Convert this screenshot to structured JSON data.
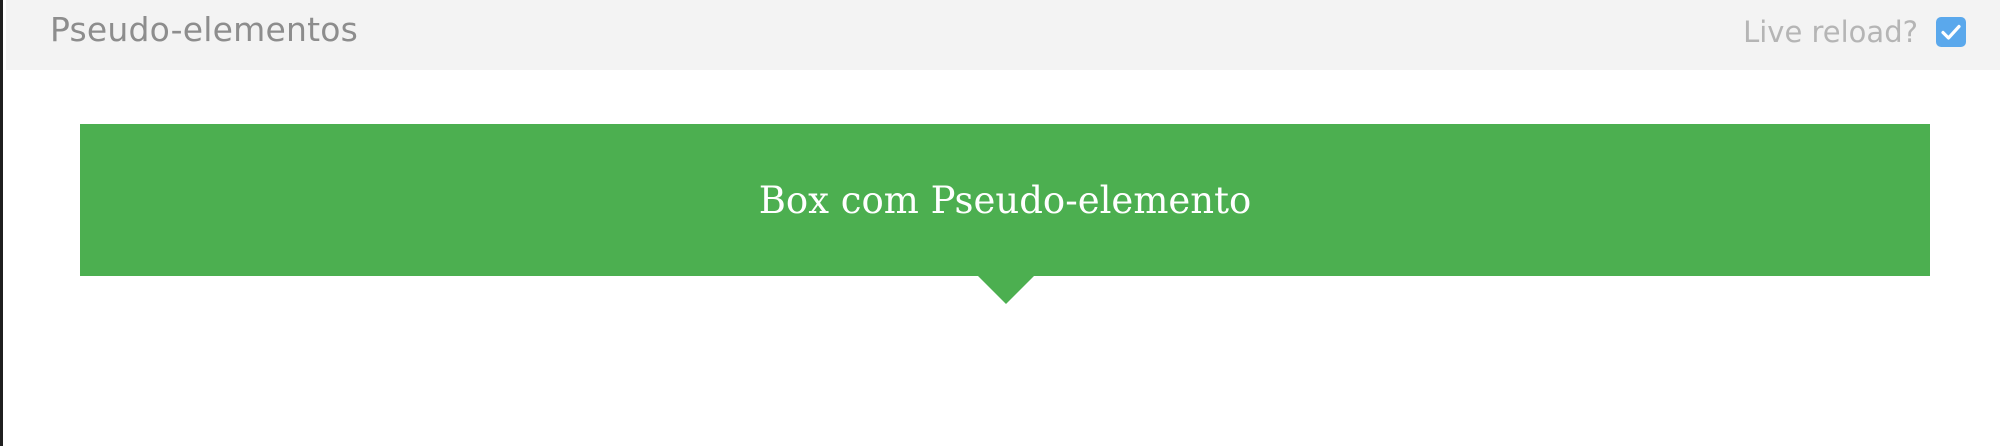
{
  "header": {
    "title": "Pseudo-elementos",
    "live_reload_label": "Live reload?",
    "live_reload_checked": true,
    "checkbox_icon": "checkmark-icon"
  },
  "preview": {
    "box_label": "Box com Pseudo-elemento",
    "pointer_icon": "triangle-down-icon"
  },
  "colors": {
    "header_background": "#f3f3f3",
    "title_text": "#8d8d8d",
    "checkbox_accent": "#5aa8ec",
    "box_background": "#4caf50",
    "box_text": "#ffffff"
  }
}
